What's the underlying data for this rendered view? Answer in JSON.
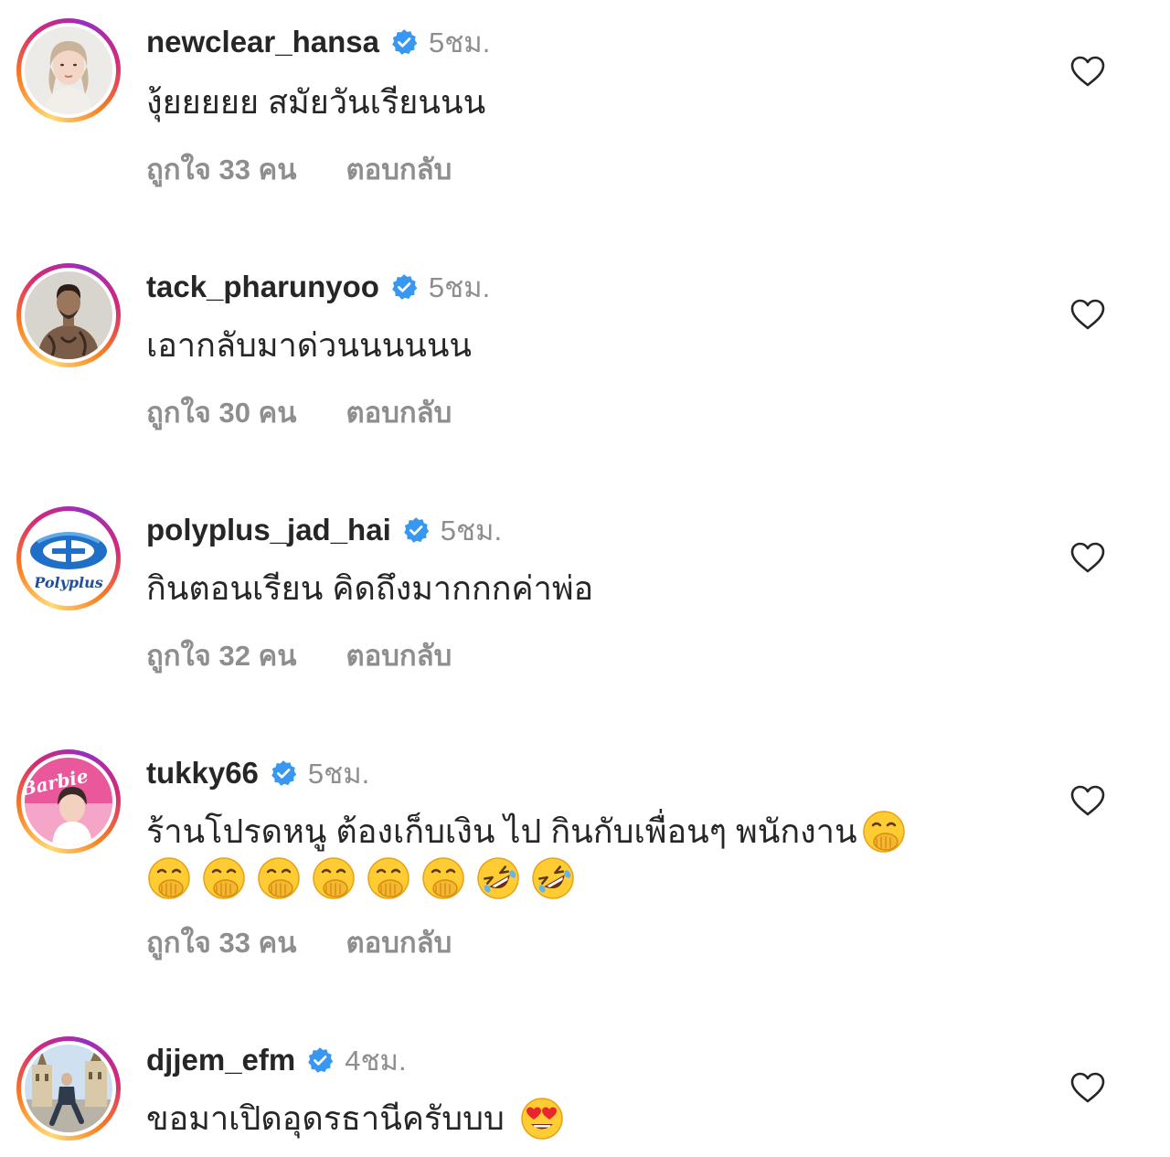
{
  "comments": [
    {
      "username": "newclear_hansa",
      "time": "5ชม.",
      "text": "งุ้ยยยยย สมัยวันเรียนนน",
      "likes": "ถูกใจ 33 คน",
      "reply": "ตอบกลับ"
    },
    {
      "username": "tack_pharunyoo",
      "time": "5ชม.",
      "text": "เอากลับมาด่วนนนนนน",
      "likes": "ถูกใจ 30 คน",
      "reply": "ตอบกลับ"
    },
    {
      "username": "polyplus_jad_hai",
      "time": "5ชม.",
      "text": "กินตอนเรียน คิดถึงมากกกค่าพ่อ",
      "likes": "ถูกใจ 32 คน",
      "reply": "ตอบกลับ",
      "avatar_text": "Polyplus"
    },
    {
      "username": "tukky66",
      "time": "5ชม.",
      "text": "ร้านโปรดหนู ต้องเก็บเงิน ไป กินกับเพื่อนๆ พนักงาน",
      "likes": "ถูกใจ 33 คน",
      "reply": "ตอบกลับ",
      "avatar_text": "Barbie"
    },
    {
      "username": "djjem_efm",
      "time": "4ชม.",
      "text": "ขอมาเปิดอุดรธานีครับบบ",
      "likes": "",
      "reply": ""
    }
  ],
  "icons": {
    "verified": "verified-badge-icon",
    "heart": "heart-outline-icon",
    "emoji_hand_over_mouth": "face-with-hand-over-mouth",
    "emoji_rofl": "rolling-on-the-floor-laughing",
    "emoji_heart_eyes": "smiling-face-with-heart-eyes"
  },
  "colors": {
    "verified": "#3897f0",
    "muted": "#8e8e8e",
    "text": "#262626"
  }
}
